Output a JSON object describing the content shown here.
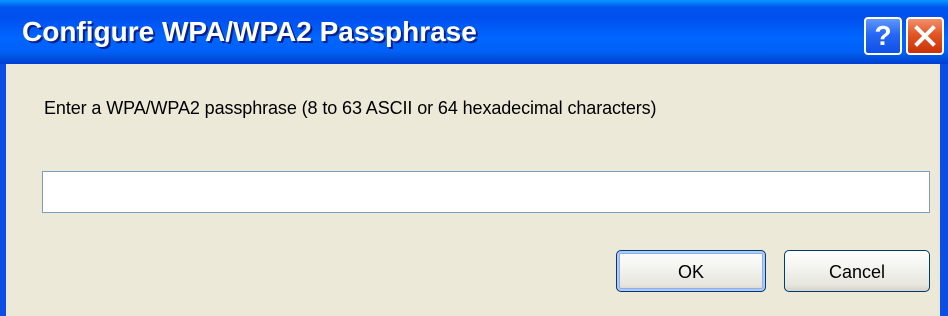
{
  "dialog": {
    "title": "Configure WPA/WPA2 Passphrase",
    "help_button_label": "?",
    "close_icon": "close-icon",
    "prompt": "Enter a WPA/WPA2 passphrase (8 to 63 ASCII or 64 hexadecimal characters)",
    "passphrase_value": "",
    "ok_label": "OK",
    "cancel_label": "Cancel"
  },
  "colors": {
    "titlebar_blue": "#0053ee",
    "window_face": "#ece9d8",
    "close_red": "#e35524"
  }
}
